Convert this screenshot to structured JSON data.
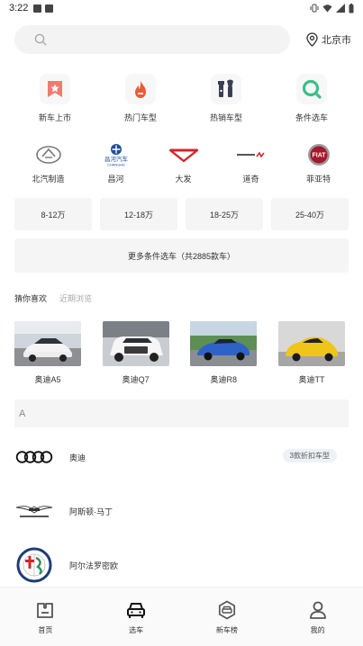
{
  "status": {
    "time": "3:22"
  },
  "search": {
    "placeholder": ""
  },
  "city": "北京市",
  "quick": [
    {
      "label": "新车上市",
      "icon": "new-car-icon",
      "color": "#f07a72"
    },
    {
      "label": "热门车型",
      "icon": "fire-icon",
      "color": "#ee5a36"
    },
    {
      "label": "热销车型",
      "icon": "tools-icon",
      "color": "#3a3f55"
    },
    {
      "label": "条件选车",
      "icon": "filter-search-icon",
      "color": "#3bbf8a"
    }
  ],
  "brands": [
    {
      "label": "北汽制造",
      "icon": "baic-logo-icon"
    },
    {
      "label": "昌河",
      "icon": "changhe-logo-icon"
    },
    {
      "label": "大发",
      "icon": "daihatsu-logo-icon"
    },
    {
      "label": "道奇",
      "icon": "dodge-logo-icon"
    },
    {
      "label": "菲亚特",
      "icon": "fiat-logo-icon"
    }
  ],
  "price_ranges": [
    "8-12万",
    "12-18万",
    "18-25万",
    "25-40万"
  ],
  "more_filter": "更多条件选车（共2885款车）",
  "tabs": {
    "active": "猜你喜欢",
    "inactive": "近期浏览"
  },
  "recommendations": [
    {
      "label": "奥迪A5",
      "color": "#dfe3e8"
    },
    {
      "label": "奥迪Q7",
      "color": "#f2f2f2"
    },
    {
      "label": "奥迪R8",
      "color": "#2f62c9"
    },
    {
      "label": "奥迪TT",
      "color": "#f0c51a"
    }
  ],
  "letter": "A",
  "brand_list": [
    {
      "name": "奥迪",
      "icon": "audi-logo-icon",
      "badge": "3款折扣车型"
    },
    {
      "name": "阿斯顿·马丁",
      "icon": "aston-martin-logo-icon",
      "badge": ""
    },
    {
      "name": "阿尔法罗密欧",
      "icon": "alfa-romeo-logo-icon",
      "badge": ""
    }
  ],
  "tabbar": [
    {
      "label": "首页",
      "icon": "home-icon"
    },
    {
      "label": "选车",
      "icon": "car-select-icon"
    },
    {
      "label": "新车榜",
      "icon": "new-car-rank-icon"
    },
    {
      "label": "我的",
      "icon": "profile-icon"
    }
  ]
}
